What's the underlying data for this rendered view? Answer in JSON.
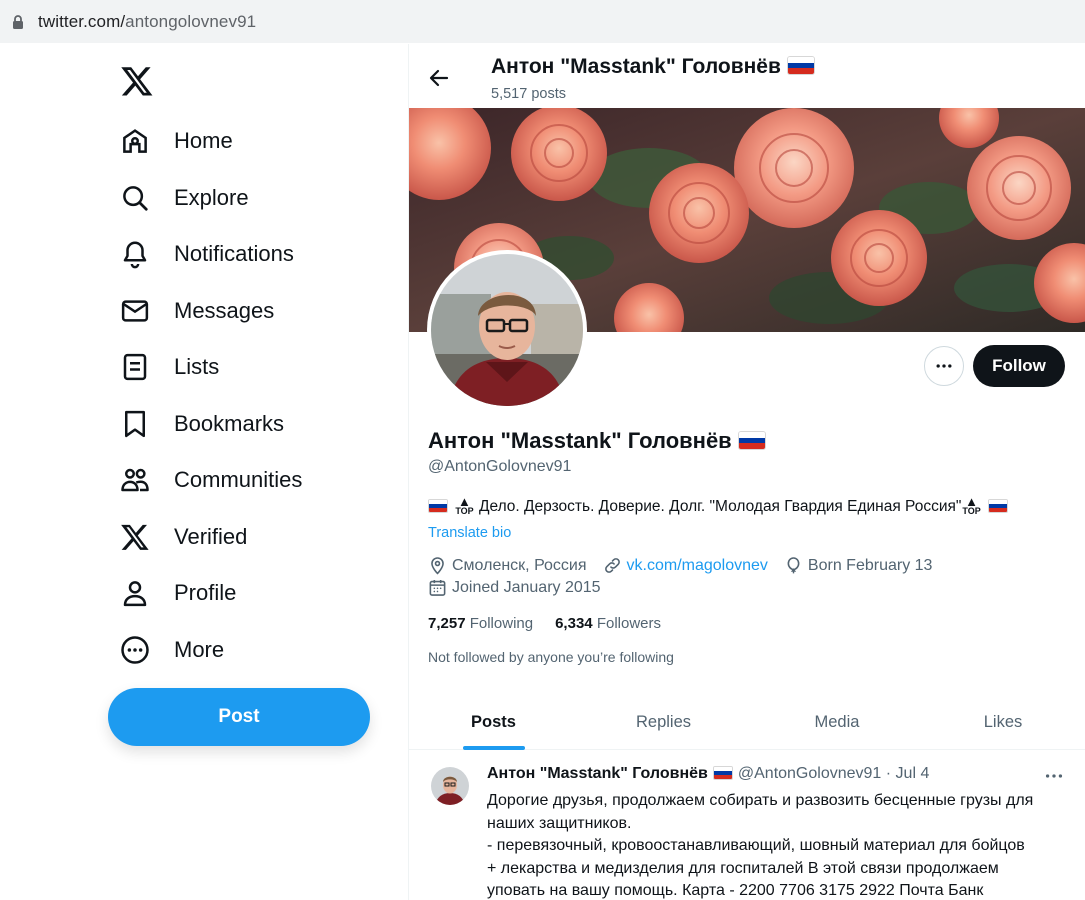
{
  "browser": {
    "url_host": "twitter.com/",
    "url_path": "antongolovnev91"
  },
  "sidebar": {
    "items": [
      {
        "label": "Home",
        "icon": "home-icon"
      },
      {
        "label": "Explore",
        "icon": "search-icon"
      },
      {
        "label": "Notifications",
        "icon": "bell-icon"
      },
      {
        "label": "Messages",
        "icon": "envelope-icon"
      },
      {
        "label": "Lists",
        "icon": "list-icon"
      },
      {
        "label": "Bookmarks",
        "icon": "bookmark-icon"
      },
      {
        "label": "Communities",
        "icon": "people-icon"
      },
      {
        "label": "Verified",
        "icon": "x-logo-icon"
      },
      {
        "label": "Profile",
        "icon": "person-icon"
      },
      {
        "label": "More",
        "icon": "more-circle-icon"
      }
    ],
    "post_label": "Post"
  },
  "header": {
    "name": "Антон \"Masstank\" Головнёв",
    "posts_count": "5,517 posts"
  },
  "profile": {
    "name": "Антон \"Masstank\" Головнёв",
    "handle": "@AntonGolovnev91",
    "follow_label": "Follow",
    "bio_text": "Дело. Дерзость. Доверие. Долг. \"Молодая Гвардия Единая Россия\"",
    "top_emoji": "TOP",
    "translate_label": "Translate bio",
    "location": "Смоленск, Россия",
    "website": "vk.com/magolovnev",
    "birthday": "Born February 13",
    "joined": "Joined January 2015",
    "following_count": "7,257",
    "following_label": "Following",
    "followers_count": "6,334",
    "followers_label": "Followers",
    "not_followed": "Not followed by anyone you’re following"
  },
  "tabs": [
    {
      "label": "Posts",
      "active": true
    },
    {
      "label": "Replies",
      "active": false
    },
    {
      "label": "Media",
      "active": false
    },
    {
      "label": "Likes",
      "active": false
    }
  ],
  "tweet": {
    "author": "Антон \"Masstank\" Головнёв",
    "meta": "@AntonGolovnev91 · Jul 4",
    "lines": [
      "Дорогие друзья, продолжаем собирать и развозить бесценные грузы для",
      "наших защитников.",
      "- перевязочный, кровоостанавливающий, шовный материал для бойцов",
      "+ лекарства и медизделия для госпиталей В этой связи продолжаем",
      "уповать на вашу помощь. Карта - 2200 7706 3175 2922  Почта Банк"
    ]
  },
  "colors": {
    "accent": "#1d9bf0",
    "text": "#0f1419",
    "secondary": "#536471",
    "follow_bg": "#0f1419"
  }
}
